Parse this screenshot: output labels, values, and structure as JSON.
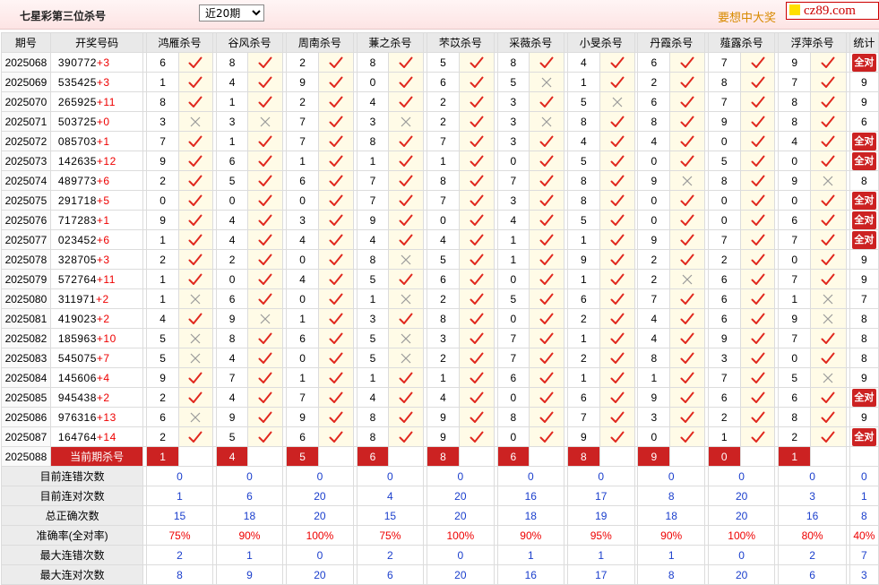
{
  "header": {
    "title": "七星彩第三位杀号",
    "select_value": "近20期",
    "slogan": "要想中大奖",
    "logo_text": "cz89.com"
  },
  "columns": {
    "issue": "期号",
    "numbers": "开奖号码",
    "stat": "统计",
    "experts": [
      "鸿雁杀号",
      "谷风杀号",
      "周南杀号",
      "蒹之杀号",
      "芣苡杀号",
      "采薇杀号",
      "小旻杀号",
      "丹霞杀号",
      "薤露杀号",
      "浮萍杀号"
    ]
  },
  "all_correct_label": "全对",
  "rows": [
    {
      "issue": "2025068",
      "nums": "390772",
      "plus": "+3",
      "kills": [
        "6",
        "8",
        "2",
        "8",
        "5",
        "8",
        "4",
        "6",
        "7",
        "9"
      ],
      "res": [
        1,
        1,
        1,
        1,
        1,
        1,
        1,
        1,
        1,
        1
      ],
      "stat": "全对"
    },
    {
      "issue": "2025069",
      "nums": "535425",
      "plus": "+3",
      "kills": [
        "1",
        "4",
        "9",
        "0",
        "6",
        "5",
        "1",
        "2",
        "8",
        "7"
      ],
      "res": [
        1,
        1,
        1,
        1,
        1,
        0,
        1,
        1,
        1,
        1
      ],
      "stat": "9"
    },
    {
      "issue": "2025070",
      "nums": "265925",
      "plus": "+11",
      "kills": [
        "8",
        "1",
        "2",
        "4",
        "2",
        "3",
        "5",
        "6",
        "7",
        "8"
      ],
      "res": [
        1,
        1,
        1,
        1,
        1,
        1,
        0,
        1,
        1,
        1
      ],
      "stat": "9"
    },
    {
      "issue": "2025071",
      "nums": "503725",
      "plus": "+0",
      "kills": [
        "3",
        "3",
        "7",
        "3",
        "2",
        "3",
        "8",
        "8",
        "9",
        "8"
      ],
      "res": [
        0,
        0,
        1,
        0,
        1,
        0,
        1,
        1,
        1,
        1
      ],
      "stat": "6"
    },
    {
      "issue": "2025072",
      "nums": "085703",
      "plus": "+1",
      "kills": [
        "7",
        "1",
        "7",
        "8",
        "7",
        "3",
        "4",
        "4",
        "0",
        "4"
      ],
      "res": [
        1,
        1,
        1,
        1,
        1,
        1,
        1,
        1,
        1,
        1
      ],
      "stat": "全对"
    },
    {
      "issue": "2025073",
      "nums": "142635",
      "plus": "+12",
      "kills": [
        "9",
        "6",
        "1",
        "1",
        "1",
        "0",
        "5",
        "0",
        "5",
        "0"
      ],
      "res": [
        1,
        1,
        1,
        1,
        1,
        1,
        1,
        1,
        1,
        1
      ],
      "stat": "全对"
    },
    {
      "issue": "2025074",
      "nums": "489773",
      "plus": "+6",
      "kills": [
        "2",
        "5",
        "6",
        "7",
        "8",
        "7",
        "8",
        "9",
        "8",
        "9"
      ],
      "res": [
        1,
        1,
        1,
        1,
        1,
        1,
        1,
        0,
        1,
        0
      ],
      "stat": "8"
    },
    {
      "issue": "2025075",
      "nums": "291718",
      "plus": "+5",
      "kills": [
        "0",
        "0",
        "0",
        "7",
        "7",
        "3",
        "8",
        "0",
        "0",
        "0"
      ],
      "res": [
        1,
        1,
        1,
        1,
        1,
        1,
        1,
        1,
        1,
        1
      ],
      "stat": "全对"
    },
    {
      "issue": "2025076",
      "nums": "717283",
      "plus": "+1",
      "kills": [
        "9",
        "4",
        "3",
        "9",
        "0",
        "4",
        "5",
        "0",
        "0",
        "6"
      ],
      "res": [
        1,
        1,
        1,
        1,
        1,
        1,
        1,
        1,
        1,
        1
      ],
      "stat": "全对"
    },
    {
      "issue": "2025077",
      "nums": "023452",
      "plus": "+6",
      "kills": [
        "1",
        "4",
        "4",
        "4",
        "4",
        "1",
        "1",
        "9",
        "7",
        "7"
      ],
      "res": [
        1,
        1,
        1,
        1,
        1,
        1,
        1,
        1,
        1,
        1
      ],
      "stat": "全对"
    },
    {
      "issue": "2025078",
      "nums": "328705",
      "plus": "+3",
      "kills": [
        "2",
        "2",
        "0",
        "8",
        "5",
        "1",
        "9",
        "2",
        "2",
        "0"
      ],
      "res": [
        1,
        1,
        1,
        0,
        1,
        1,
        1,
        1,
        1,
        1
      ],
      "stat": "9"
    },
    {
      "issue": "2025079",
      "nums": "572764",
      "plus": "+11",
      "kills": [
        "1",
        "0",
        "4",
        "5",
        "6",
        "0",
        "1",
        "2",
        "6",
        "7"
      ],
      "res": [
        1,
        1,
        1,
        1,
        1,
        1,
        1,
        0,
        1,
        1
      ],
      "stat": "9"
    },
    {
      "issue": "2025080",
      "nums": "311971",
      "plus": "+2",
      "kills": [
        "1",
        "6",
        "0",
        "1",
        "2",
        "5",
        "6",
        "7",
        "6",
        "1"
      ],
      "res": [
        0,
        1,
        1,
        0,
        1,
        1,
        1,
        1,
        1,
        0
      ],
      "stat": "7"
    },
    {
      "issue": "2025081",
      "nums": "419023",
      "plus": "+2",
      "kills": [
        "4",
        "9",
        "1",
        "3",
        "8",
        "0",
        "2",
        "4",
        "6",
        "9"
      ],
      "res": [
        1,
        0,
        1,
        1,
        1,
        1,
        1,
        1,
        1,
        0
      ],
      "stat": "8"
    },
    {
      "issue": "2025082",
      "nums": "185963",
      "plus": "+10",
      "kills": [
        "5",
        "8",
        "6",
        "5",
        "3",
        "7",
        "1",
        "4",
        "9",
        "7"
      ],
      "res": [
        0,
        1,
        1,
        0,
        1,
        1,
        1,
        1,
        1,
        1
      ],
      "stat": "8"
    },
    {
      "issue": "2025083",
      "nums": "545075",
      "plus": "+7",
      "kills": [
        "5",
        "4",
        "0",
        "5",
        "2",
        "7",
        "2",
        "8",
        "3",
        "0"
      ],
      "res": [
        0,
        1,
        1,
        0,
        1,
        1,
        1,
        1,
        1,
        1
      ],
      "stat": "8"
    },
    {
      "issue": "2025084",
      "nums": "145606",
      "plus": "+4",
      "kills": [
        "9",
        "7",
        "1",
        "1",
        "1",
        "6",
        "1",
        "1",
        "7",
        "5"
      ],
      "res": [
        1,
        1,
        1,
        1,
        1,
        1,
        1,
        1,
        1,
        0
      ],
      "stat": "9"
    },
    {
      "issue": "2025085",
      "nums": "945438",
      "plus": "+2",
      "kills": [
        "2",
        "4",
        "7",
        "4",
        "4",
        "0",
        "6",
        "9",
        "6",
        "6"
      ],
      "res": [
        1,
        1,
        1,
        1,
        1,
        1,
        1,
        1,
        1,
        1
      ],
      "stat": "全对"
    },
    {
      "issue": "2025086",
      "nums": "976316",
      "plus": "+13",
      "kills": [
        "6",
        "9",
        "9",
        "8",
        "9",
        "8",
        "7",
        "3",
        "2",
        "8"
      ],
      "res": [
        0,
        1,
        1,
        1,
        1,
        1,
        1,
        1,
        1,
        1
      ],
      "stat": "9"
    },
    {
      "issue": "2025087",
      "nums": "164764",
      "plus": "+14",
      "kills": [
        "2",
        "5",
        "6",
        "8",
        "9",
        "0",
        "9",
        "0",
        "1",
        "2"
      ],
      "res": [
        1,
        1,
        1,
        1,
        1,
        1,
        1,
        1,
        1,
        1
      ],
      "stat": "全对"
    }
  ],
  "current": {
    "issue": "2025088",
    "label": "当前期杀号",
    "kills": [
      "1",
      "4",
      "5",
      "6",
      "8",
      "6",
      "8",
      "9",
      "0",
      "1"
    ]
  },
  "stats": [
    {
      "label": "目前连错次数",
      "values": [
        "0",
        "0",
        "0",
        "0",
        "0",
        "0",
        "0",
        "0",
        "0",
        "0"
      ],
      "total": "0"
    },
    {
      "label": "目前连对次数",
      "values": [
        "1",
        "6",
        "20",
        "4",
        "20",
        "16",
        "17",
        "8",
        "20",
        "3"
      ],
      "total": "1"
    },
    {
      "label": "总正确次数",
      "values": [
        "15",
        "18",
        "20",
        "15",
        "20",
        "18",
        "19",
        "18",
        "20",
        "16"
      ],
      "total": "8"
    },
    {
      "label": "准确率(全对率)",
      "values": [
        "75%",
        "90%",
        "100%",
        "75%",
        "100%",
        "90%",
        "95%",
        "90%",
        "100%",
        "80%"
      ],
      "total": "40%",
      "is_rate": true
    },
    {
      "label": "最大连错次数",
      "values": [
        "2",
        "1",
        "0",
        "2",
        "0",
        "1",
        "1",
        "1",
        "0",
        "2"
      ],
      "total": "7"
    },
    {
      "label": "最大连对次数",
      "values": [
        "8",
        "9",
        "20",
        "6",
        "20",
        "16",
        "17",
        "8",
        "20",
        "6"
      ],
      "total": "3"
    }
  ]
}
